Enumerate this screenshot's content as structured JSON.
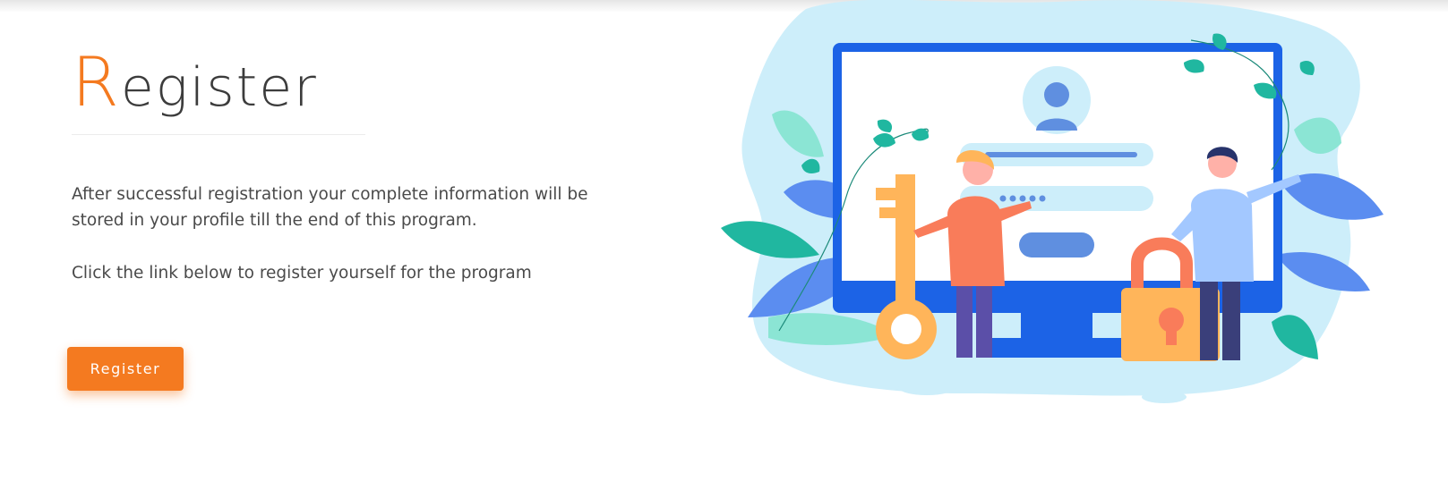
{
  "title": {
    "first_letter": "R",
    "rest": "egister"
  },
  "description": "After successful registration your complete information will be stored in your profile till the end of this program.",
  "cta_text": "Click the link below to register yourself for the program",
  "register_button": {
    "label": "Register"
  },
  "colors": {
    "accent": "#f47a20",
    "monitor_blue": "#1c63e6",
    "blob": "#cdeefa",
    "teal_leaf": "#20b7a0",
    "blue_leaf": "#5b8df0"
  },
  "illustration": {
    "icons": [
      "monitor-icon",
      "user-avatar-icon",
      "key-icon",
      "padlock-icon",
      "woman-figure",
      "man-figure",
      "leaf-icon"
    ]
  }
}
